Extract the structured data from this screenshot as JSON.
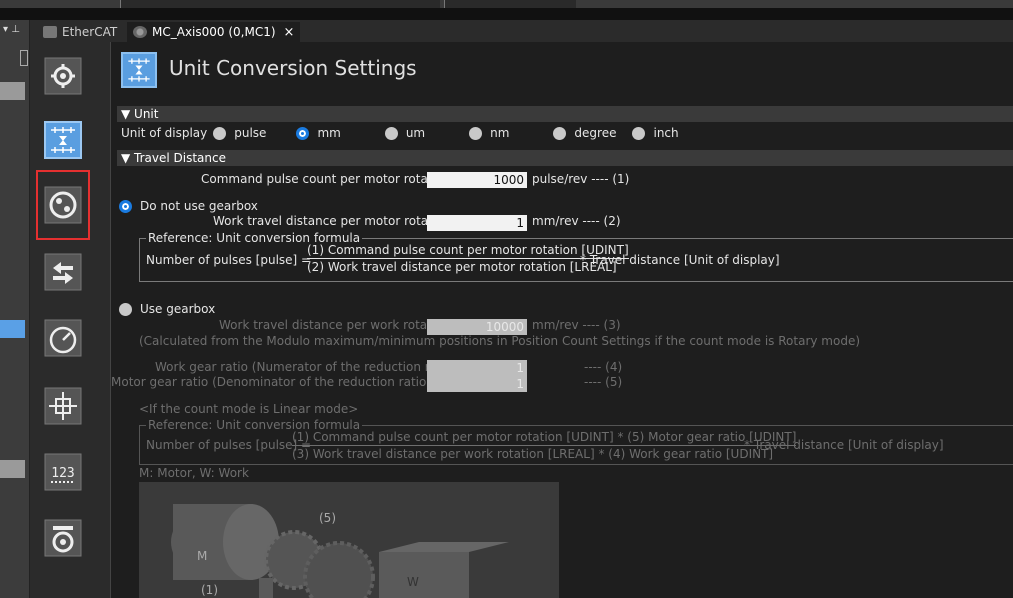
{
  "tabs": [
    {
      "label": "EtherCAT"
    },
    {
      "label": "MC_Axis000 (0,MC1)"
    }
  ],
  "close_glyph": "×",
  "page_title": "Unit Conversion Settings",
  "section_unit": "▼ Unit",
  "unit_label": "Unit of display",
  "units": [
    "pulse",
    "mm",
    "um",
    "nm",
    "degree",
    "inch"
  ],
  "selected_unit": "mm",
  "section_travel": "▼ Travel Distance",
  "cmd_pulse_label": "Command pulse count per motor rotation",
  "cmd_pulse_value": "1000",
  "cmd_pulse_unit": "pulse/rev ---- (1)",
  "no_gearbox_label": "Do not use gearbox",
  "work_travel_label": "Work travel distance per motor rotation",
  "work_travel_value": "1",
  "work_travel_unit": "mm/rev   ---- (2)",
  "ref_legend": "Reference: Unit conversion formula",
  "formula1": {
    "lhs": "Number of pulses [pulse] =",
    "num": "(1) Command pulse count per motor rotation [UDINT]",
    "den": "(2) Work travel distance per motor rotation [LREAL]",
    "rhs": "* Travel distance [Unit of display]"
  },
  "use_gearbox_label": "Use gearbox",
  "work_rot_label": "Work travel distance per work rotation",
  "work_rot_value": "10000",
  "work_rot_unit": "mm/rev   ---- (3)",
  "calc_note": "(Calculated from the Modulo maximum/minimum positions in Position Count Settings if the count mode is Rotary mode)",
  "work_gear_label": "Work gear ratio (Numerator of the reduction ratio)",
  "work_gear_value": "1",
  "work_gear_unit": "---- (4)",
  "motor_gear_label": "Motor gear ratio (Denominator of the reduction ratio)",
  "motor_gear_value": "1",
  "motor_gear_unit": "---- (5)",
  "linear_note": "<If the count mode is Linear mode>",
  "formula2": {
    "lhs": "Number of pulses [pulse] =",
    "num": "(1) Command pulse count per motor rotation [UDINT] * (5) Motor gear ratio [UDINT]",
    "den": "(3) Work travel distance per work rotation [LREAL] * (4) Work gear ratio [UDINT]",
    "rhs": "* Travel distance [Unit of display]"
  },
  "legend_mw": "M: Motor, W: Work",
  "diagram_labels": {
    "m": "M",
    "w": "W",
    "five": "(5)",
    "one": "(1)"
  },
  "rail_icons": [
    "settings-gear-icon",
    "unit-conversion-icon",
    "operation-icon",
    "limit-icon",
    "speed-gauge-icon",
    "position-icon",
    "count-icon",
    "servo-icon"
  ]
}
